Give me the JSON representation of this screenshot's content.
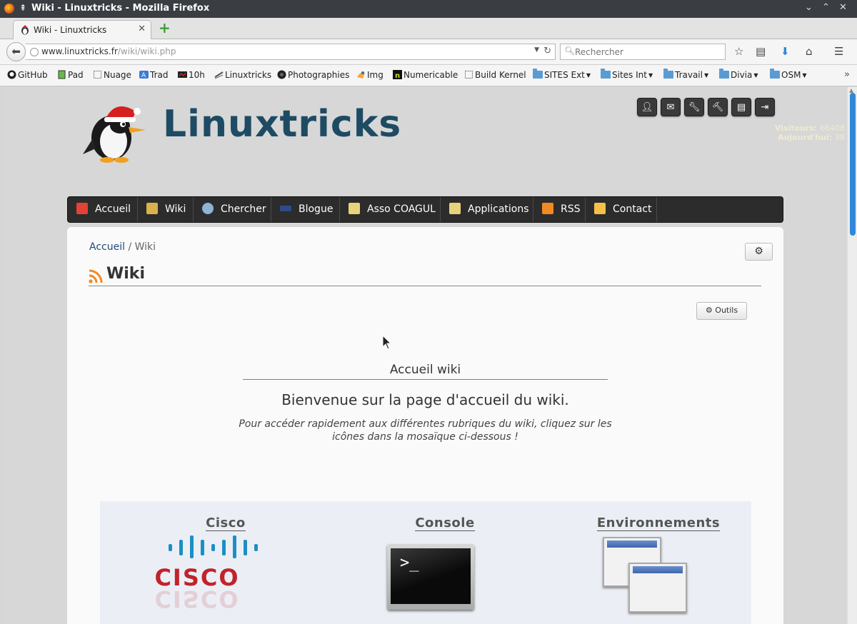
{
  "window": {
    "title": "Wiki - Linuxtricks - Mozilla Firefox"
  },
  "tab": {
    "label": "Wiki - Linuxtricks"
  },
  "urlbar": {
    "domain": "www.linuxtricks.fr",
    "path": "/wiki/wiki.php"
  },
  "search": {
    "placeholder": "Rechercher"
  },
  "bookmarks": [
    {
      "label": "GitHub",
      "icon": "github-icon"
    },
    {
      "label": "Pad",
      "icon": "pad-icon"
    },
    {
      "label": "Nuage",
      "icon": "page-icon"
    },
    {
      "label": "Trad",
      "icon": "translate-icon"
    },
    {
      "label": "10h",
      "icon": "clock-icon"
    },
    {
      "label": "Linuxtricks",
      "icon": "linuxtricks-icon"
    },
    {
      "label": "Photographies",
      "icon": "camera-icon"
    },
    {
      "label": "Img",
      "icon": "image-icon"
    },
    {
      "label": "Numericable",
      "icon": "numericable-icon"
    },
    {
      "label": "Build Kernel",
      "icon": "page-icon"
    },
    {
      "label": "SITES Ext",
      "icon": "folder-icon"
    },
    {
      "label": "Sites Int",
      "icon": "folder-icon"
    },
    {
      "label": "Travail",
      "icon": "folder-icon"
    },
    {
      "label": "Divia",
      "icon": "folder-icon"
    },
    {
      "label": "OSM",
      "icon": "folder-icon"
    }
  ],
  "site": {
    "name": "Linuxtricks",
    "visitors_label": "Visiteurs:",
    "visitors_value": "66408",
    "today_label": "Aujourd'hui:",
    "today_value": "38"
  },
  "menu": [
    "Accueil",
    "Wiki",
    "Chercher",
    "Blogue",
    "Asso COAGUL",
    "Applications",
    "RSS",
    "Contact"
  ],
  "breadcrumb": {
    "home": "Accueil",
    "sep": " / ",
    "current": "Wiki"
  },
  "page": {
    "title": "Wiki",
    "tools_label": "Outils",
    "welcome_heading": "Accueil wiki",
    "welcome_text": "Bienvenue sur la page d'accueil du wiki.",
    "welcome_hint": "Pour accéder rapidement aux différentes rubriques du wiki, cliquez sur les icônes dans la mosaïque ci-dessous !"
  },
  "mosaic": [
    {
      "title": "Cisco",
      "logo_text": "CISCO"
    },
    {
      "title": "Console",
      "prompt": ">_"
    },
    {
      "title": "Environnements"
    }
  ],
  "colors": {
    "menu_bg": "#2c2c2c",
    "brand": "#1e4b63",
    "link": "#1f4b7a",
    "accent_line": "#b35fa2",
    "cisco_red": "#c0232c"
  }
}
